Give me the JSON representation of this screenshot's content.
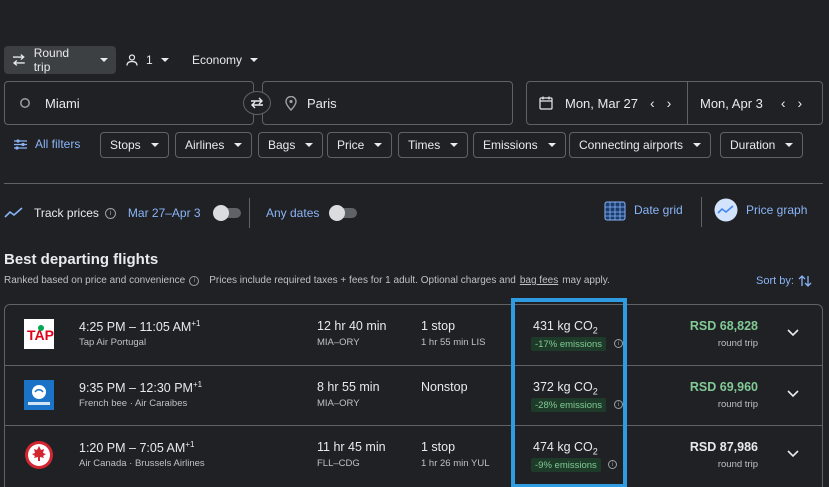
{
  "search": {
    "trip_type": "Round trip",
    "passengers": "1",
    "cabin": "Economy",
    "from": "Miami",
    "to": "Paris",
    "depart_date": "Mon, Mar 27",
    "return_date": "Mon, Apr 3"
  },
  "filters": {
    "all_filters": "All filters",
    "chips": [
      "Stops",
      "Airlines",
      "Bags",
      "Price",
      "Times",
      "Emissions",
      "Connecting airports",
      "Duration"
    ]
  },
  "track": {
    "label": "Track prices",
    "range": "Mar 27–Apr 3",
    "any_dates": "Any dates",
    "date_grid": "Date grid",
    "price_graph": "Price graph"
  },
  "results": {
    "title": "Best departing flights",
    "ranked_note": "Ranked based on price and convenience",
    "prices_note_pre": "Prices include required taxes + fees for 1 adult. Optional charges and",
    "bag_fees_link": "bag fees",
    "prices_note_post": "may apply.",
    "sort_by": "Sort by:",
    "flights": [
      {
        "times": "4:25 PM – 11:05 AM",
        "day_offset": "+1",
        "airline": "Tap Air Portugal",
        "duration": "12 hr 40 min",
        "route": "MIA–ORY",
        "stops": "1 stop",
        "layover": "1 hr 55 min LIS",
        "co2": "431 kg CO",
        "co2_sub": "2",
        "emissions_badge": "-17% emissions",
        "price": "RSD 68,828",
        "price_type": "round trip",
        "price_color": "#81c995"
      },
      {
        "times": "9:35 PM – 12:30 PM",
        "day_offset": "+1",
        "airline": "French bee · Air Caraibes",
        "duration": "8 hr 55 min",
        "route": "MIA–ORY",
        "stops": "Nonstop",
        "layover": "",
        "co2": "372 kg CO",
        "co2_sub": "2",
        "emissions_badge": "-28% emissions",
        "price": "RSD 69,960",
        "price_type": "round trip",
        "price_color": "#81c995"
      },
      {
        "times": "1:20 PM – 7:05 AM",
        "day_offset": "+1",
        "airline": "Air Canada · Brussels Airlines",
        "duration": "11 hr 45 min",
        "route": "FLL–CDG",
        "stops": "1 stop",
        "layover": "1 hr 26 min YUL",
        "co2": "474 kg CO",
        "co2_sub": "2",
        "emissions_badge": "-9% emissions",
        "price": "RSD 87,986",
        "price_type": "round trip",
        "price_color": "#e8eaed"
      }
    ]
  },
  "colors": {
    "accent": "#8ab4f8",
    "highlight": "#2f9be0",
    "good_price": "#81c995"
  }
}
